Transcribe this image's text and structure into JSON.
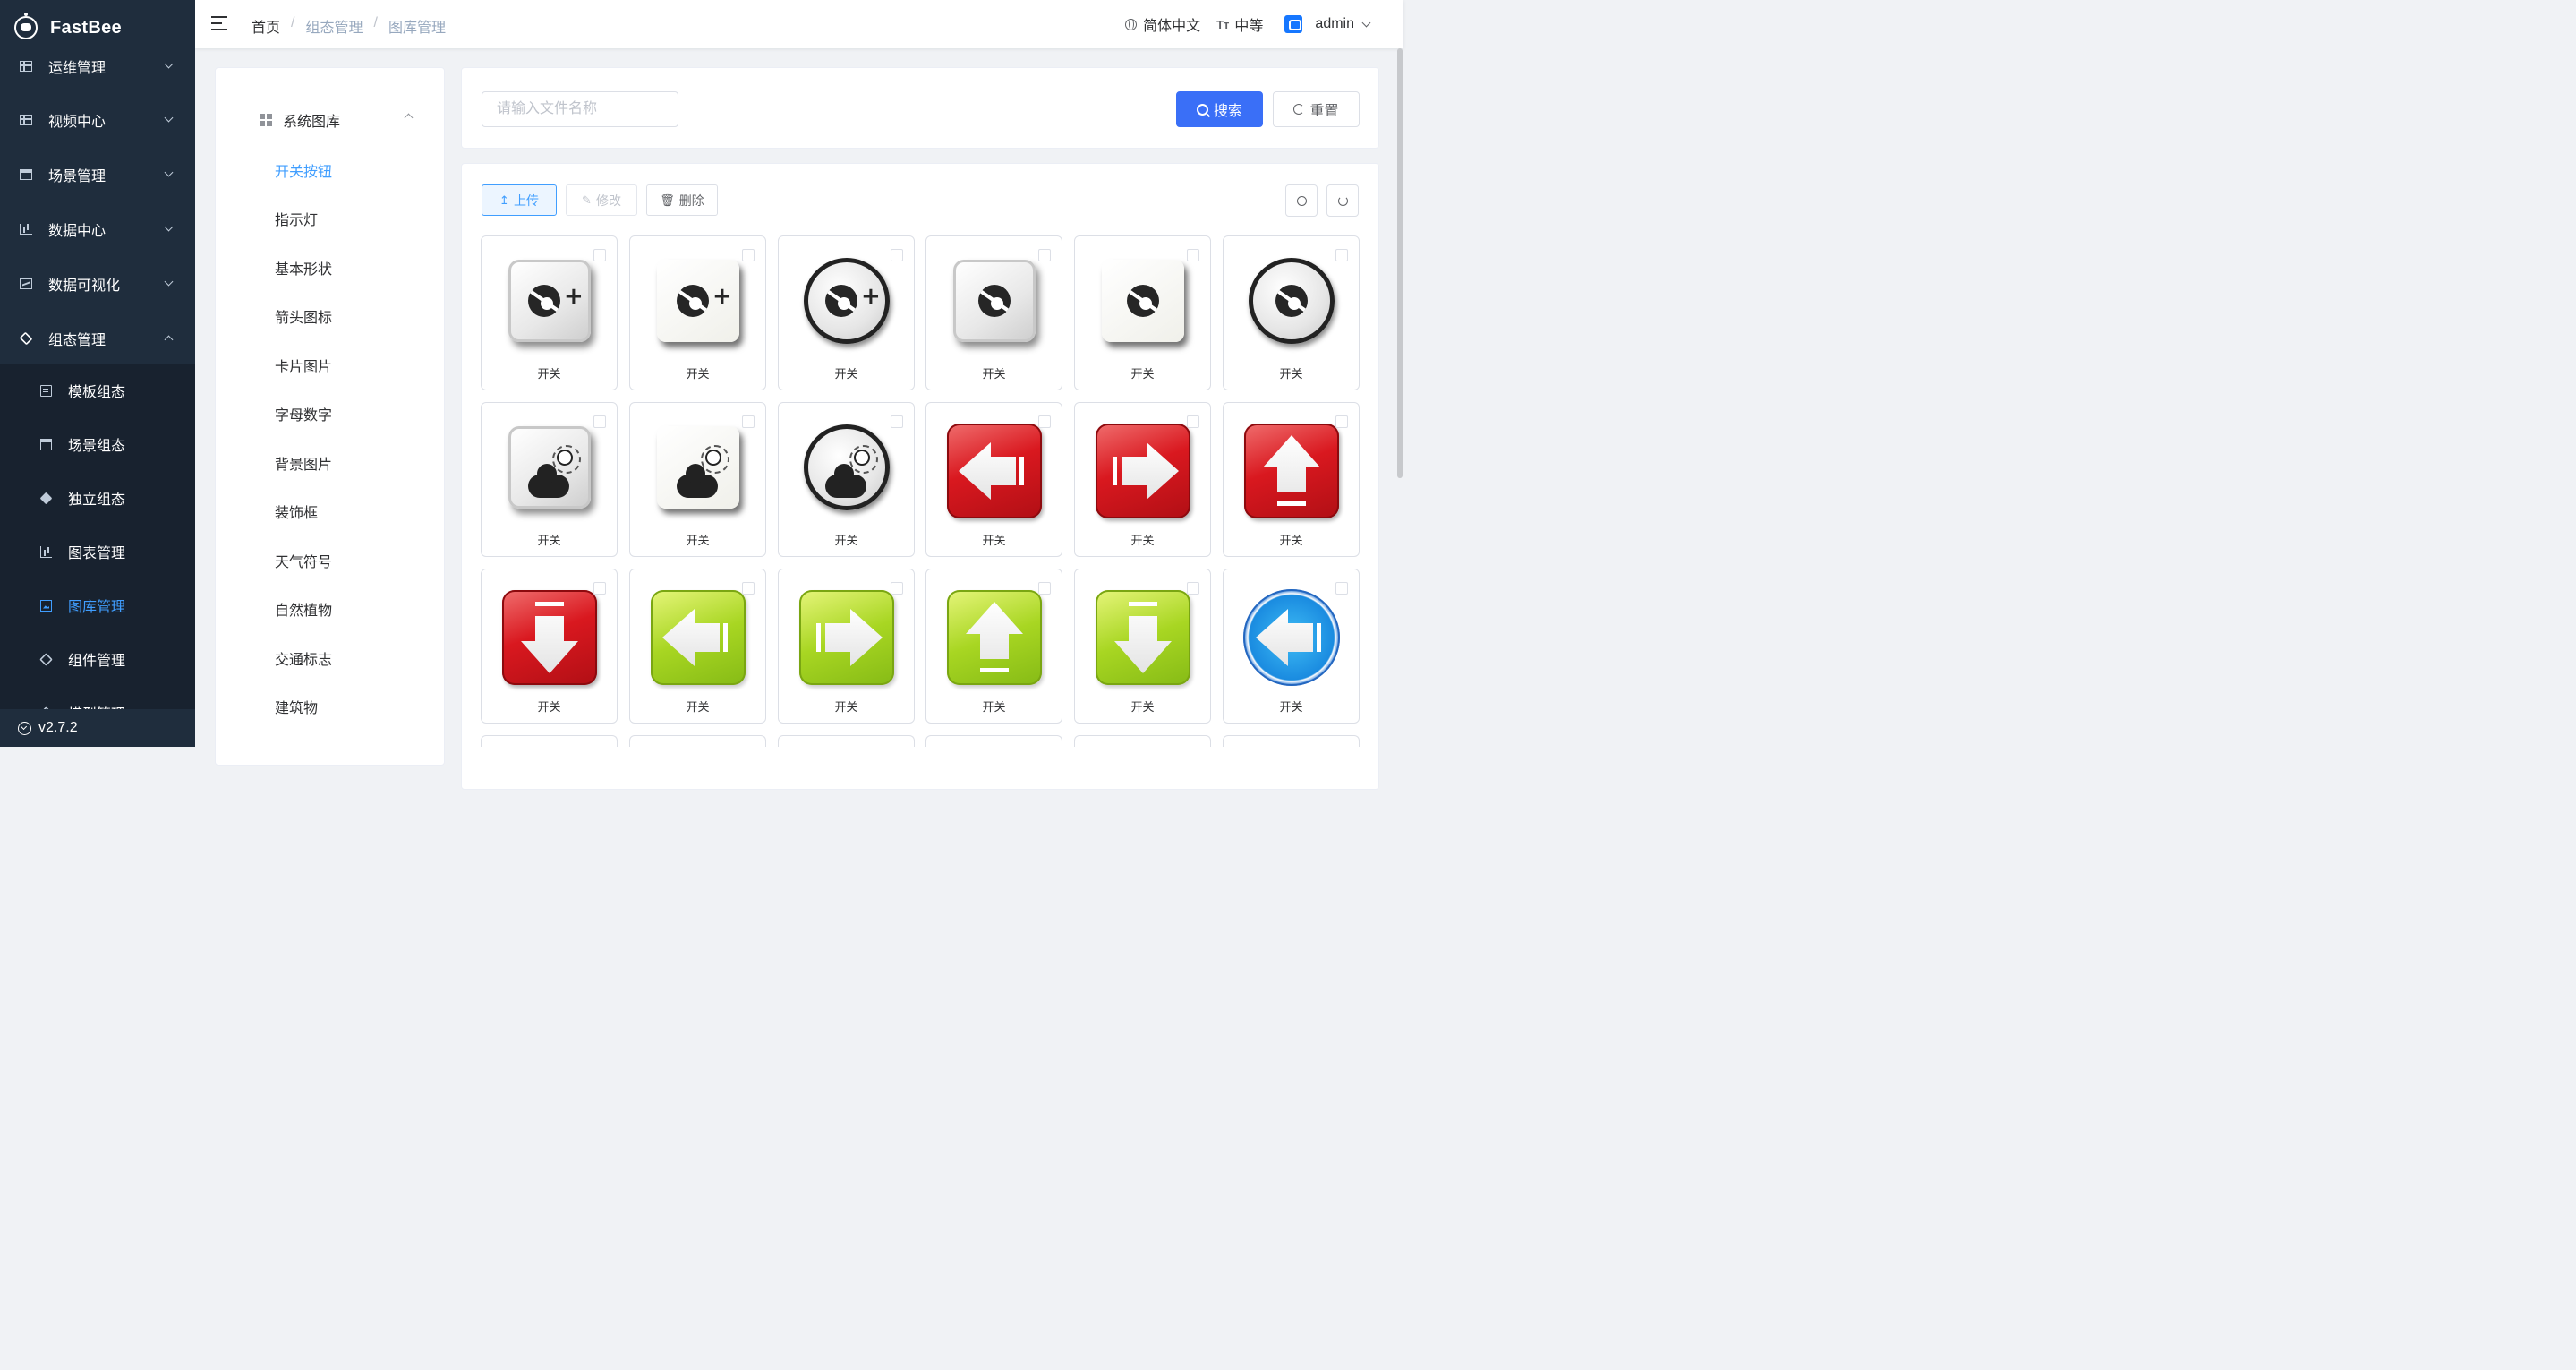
{
  "app": {
    "name": "FastBee",
    "version": "v2.7.2"
  },
  "sidebar": {
    "items": [
      {
        "label": "运维管理",
        "icon": "ops-icon"
      },
      {
        "label": "视频中心",
        "icon": "video-icon"
      },
      {
        "label": "场景管理",
        "icon": "scene-icon"
      },
      {
        "label": "数据中心",
        "icon": "bar-chart-icon"
      },
      {
        "label": "数据可视化",
        "icon": "monitor-icon"
      },
      {
        "label": "组态管理",
        "icon": "layers-icon"
      }
    ],
    "subitems": [
      {
        "label": "模板组态",
        "icon": "template-icon"
      },
      {
        "label": "场景组态",
        "icon": "scene-icon"
      },
      {
        "label": "独立组态",
        "icon": "cube-icon"
      },
      {
        "label": "图表管理",
        "icon": "bar-chart-icon"
      },
      {
        "label": "图库管理",
        "icon": "image-icon",
        "active": true
      },
      {
        "label": "组件管理",
        "icon": "layers-icon"
      },
      {
        "label": "模型管理",
        "icon": "model-icon"
      }
    ]
  },
  "header": {
    "breadcrumb": [
      "首页",
      "组态管理",
      "图库管理"
    ],
    "language": "简体中文",
    "size": "中等",
    "user": "admin"
  },
  "categories": {
    "title": "系统图库",
    "items": [
      "开关按钮",
      "指示灯",
      "基本形状",
      "箭头图标",
      "卡片图片",
      "字母数字",
      "背景图片",
      "装饰框",
      "天气符号",
      "自然植物",
      "交通标志",
      "建筑物"
    ],
    "active": "开关按钮"
  },
  "search": {
    "placeholder": "请输入文件名称",
    "value": "",
    "search_label": "搜索",
    "reset_label": "重置"
  },
  "toolbar": {
    "upload": "上传",
    "edit": "修改",
    "delete": "删除"
  },
  "gallery": {
    "items": [
      {
        "name": "开关",
        "image": "fan-plus-square-silver"
      },
      {
        "name": "开关",
        "image": "fan-plus-square-white"
      },
      {
        "name": "开关",
        "image": "fan-plus-circle"
      },
      {
        "name": "开关",
        "image": "fan-square-silver"
      },
      {
        "name": "开关",
        "image": "fan-square-white"
      },
      {
        "name": "开关",
        "image": "fan-circle"
      },
      {
        "name": "开关",
        "image": "weather-square-silver"
      },
      {
        "name": "开关",
        "image": "weather-square-white"
      },
      {
        "name": "开关",
        "image": "weather-circle"
      },
      {
        "name": "开关",
        "image": "red-arrow-left"
      },
      {
        "name": "开关",
        "image": "red-arrow-right"
      },
      {
        "name": "开关",
        "image": "red-arrow-up"
      },
      {
        "name": "开关",
        "image": "red-arrow-down"
      },
      {
        "name": "开关",
        "image": "green-arrow-left"
      },
      {
        "name": "开关",
        "image": "green-arrow-right"
      },
      {
        "name": "开关",
        "image": "green-arrow-up"
      },
      {
        "name": "开关",
        "image": "green-arrow-down"
      },
      {
        "name": "开关",
        "image": "blue-circle-arrow-left"
      }
    ]
  },
  "colors": {
    "sidebar_bg": "#1f2d3d",
    "accent": "#409eff",
    "primary_button": "#3a6ff7"
  }
}
